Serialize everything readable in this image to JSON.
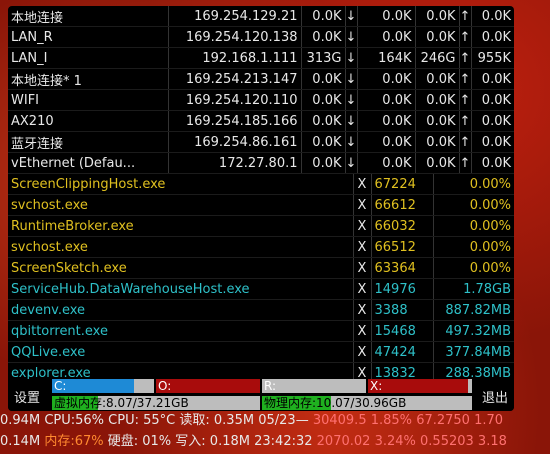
{
  "network": [
    {
      "name": "本地连接",
      "ip": "169.254.129.21",
      "up": "0.0K",
      "down": "0.0K",
      "down2": "0.0K",
      "up2": "0.0K"
    },
    {
      "name": "LAN_R",
      "ip": "169.254.120.138",
      "up": "0.0K",
      "down": "0.0K",
      "down2": "0.0K",
      "up2": "0.0K"
    },
    {
      "name": "LAN_I",
      "ip": "192.168.1.111",
      "up": "313G",
      "down": "164K",
      "down2": "246G",
      "up2": "955K"
    },
    {
      "name": "本地连接* 1",
      "ip": "169.254.213.147",
      "up": "0.0K",
      "down": "0.0K",
      "down2": "0.0K",
      "up2": "0.0K"
    },
    {
      "name": "WIFI",
      "ip": "169.254.120.110",
      "up": "0.0K",
      "down": "0.0K",
      "down2": "0.0K",
      "up2": "0.0K"
    },
    {
      "name": "AX210",
      "ip": "169.254.185.166",
      "up": "0.0K",
      "down": "0.0K",
      "down2": "0.0K",
      "up2": "0.0K"
    },
    {
      "name": "蓝牙连接",
      "ip": "169.254.86.161",
      "up": "0.0K",
      "down": "0.0K",
      "down2": "0.0K",
      "up2": "0.0K"
    },
    {
      "name": "vEthernet (Defau...",
      "ip": "172.27.80.1",
      "up": "0.0K",
      "down": "0.0K",
      "down2": "0.0K",
      "up2": "0.0K"
    }
  ],
  "arrows": {
    "down": "↓:",
    "up": "↑:"
  },
  "processes_cpu": [
    {
      "name": "ScreenClippingHost.exe",
      "kill": "X",
      "pid": "67224",
      "value": "0.00%"
    },
    {
      "name": "svchost.exe",
      "kill": "X",
      "pid": "66612",
      "value": "0.00%"
    },
    {
      "name": "RuntimeBroker.exe",
      "kill": "X",
      "pid": "66032",
      "value": "0.00%"
    },
    {
      "name": "svchost.exe",
      "kill": "X",
      "pid": "66512",
      "value": "0.00%"
    },
    {
      "name": "ScreenSketch.exe",
      "kill": "X",
      "pid": "63364",
      "value": "0.00%"
    }
  ],
  "processes_mem": [
    {
      "name": "ServiceHub.DataWarehouseHost.exe",
      "kill": "X",
      "pid": "14976",
      "value": "1.78GB"
    },
    {
      "name": "devenv.exe",
      "kill": "X",
      "pid": "3388",
      "value": "887.82MB"
    },
    {
      "name": "qbittorrent.exe",
      "kill": "X",
      "pid": "15468",
      "value": "497.32MB"
    },
    {
      "name": "QQLive.exe",
      "kill": "X",
      "pid": "47424",
      "value": "377.84MB"
    },
    {
      "name": "explorer.exe",
      "kill": "X",
      "pid": "13832",
      "value": "288.38MB"
    }
  ],
  "bottom": {
    "settings_label": "设置",
    "exit_label": "退出",
    "disk_c": {
      "label": "C:",
      "fill": 0.8,
      "color": "#1e8ad6"
    },
    "disk_o": {
      "label": "O:",
      "fill": 1.0,
      "color": "#a80c0c"
    },
    "disk_r": {
      "label": "R:",
      "fill": 0.0,
      "color": "#1e8ad6"
    },
    "disk_x": {
      "label": "X:",
      "fill": 0.96,
      "color": "#a80c0c"
    },
    "virtual_mem": {
      "label": "虚拟内存:8.07/37.21GB",
      "fill": 0.22,
      "color": "#1fb01f"
    },
    "physical_mem": {
      "label": "物理内存:10.07/30.96GB",
      "fill": 0.33,
      "color": "#1fb01f"
    }
  },
  "status": {
    "row1": {
      "a": "0.94M",
      "cpu": "CPU:56%",
      "cpu_temp": "CPU: 55°C",
      "read": "读取: 0.35M",
      "date": "05/23",
      "dash": "—",
      "v1": "30409.5",
      "v2": "1.85%",
      "v3": "67.2750",
      "v4": "1.70"
    },
    "row2": {
      "a": "0.14M",
      "mem": "内存:67%",
      "disk": "硬盘: 01%",
      "write": "写入: 0.18M",
      "time": "23:42:32",
      "v1": "2070.02",
      "v2": "3.24%",
      "v3": "0.55203",
      "v4": "3.18"
    }
  },
  "colors": {
    "cpu_process": "#e0c020",
    "mem_process": "#2ec0c8",
    "status_orange": "#ff8a30"
  }
}
